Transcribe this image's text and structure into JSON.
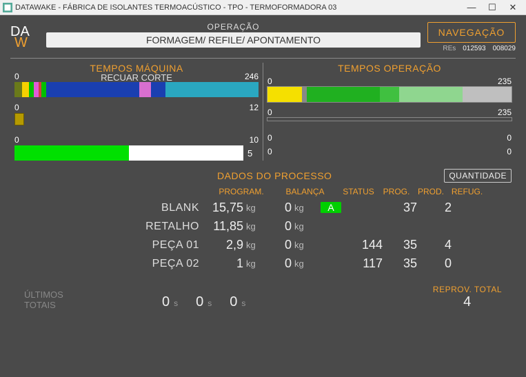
{
  "window": {
    "title": "DATAWAKE - FÁBRICA DE ISOLANTES TERMOACÚSTICO - TPO - TERMOFORMADORA 03"
  },
  "header": {
    "operacao_label": "OPERAÇÃO",
    "operacao_value": "FORMAGEM/ REFILE/ APONTAMENTO",
    "nav_label": "NAVEGAÇÃO",
    "res_label": "REs",
    "res_v1": "012593",
    "res_v2": "008029"
  },
  "charts_left": {
    "title": "TEMPOS MÁQUINA",
    "subtitle": "RECUAR CORTE",
    "bar1": {
      "min": "0",
      "max": "246"
    },
    "bar2": {
      "min": "0",
      "max": "12"
    },
    "bar3": {
      "min": "0",
      "max": "10",
      "value_label": "5"
    }
  },
  "charts_right": {
    "title": "TEMPOS OPERAÇÃO",
    "bar1": {
      "min": "0",
      "max": "235"
    },
    "bar2": {
      "min": "0",
      "max": "235"
    },
    "small1": {
      "l": "0",
      "r": "0"
    },
    "small2": {
      "l": "0",
      "r": "0"
    }
  },
  "process": {
    "title": "DADOS DO PROCESSO",
    "qty_label": "QUANTIDADE",
    "cols": {
      "program": "PROGRAM.",
      "balanca": "BALANÇA",
      "status": "STATUS",
      "prog": "PROG.",
      "prod": "PROD.",
      "refug": "REFUG."
    },
    "unit_kg": "kg",
    "rows": [
      {
        "label": "BLANK",
        "program": "15,75",
        "bal": "0",
        "status": "A",
        "prog": "",
        "prod": "37",
        "refug": "2"
      },
      {
        "label": "RETALHO",
        "program": "11,85",
        "bal": "0",
        "status": "",
        "prog": "",
        "prod": "",
        "refug": ""
      },
      {
        "label": "PEÇA 01",
        "program": "2,9",
        "bal": "0",
        "status": "",
        "prog": "144",
        "prod": "35",
        "refug": "4"
      },
      {
        "label": "PEÇA 02",
        "program": "1",
        "bal": "0",
        "status": "",
        "prog": "117",
        "prod": "35",
        "refug": "0"
      }
    ]
  },
  "footer": {
    "left_l1": "ÚLTIMOS",
    "left_l2": "TOTAIS",
    "t1": "0",
    "u1": "s",
    "t2": "0",
    "u2": "s",
    "t3": "0",
    "u3": "s",
    "reprov_label": "REPROV. TOTAL",
    "reprov_value": "4"
  },
  "chart_data": [
    {
      "type": "bar",
      "title": "TEMPOS MÁQUINA — bar 1 (RECUAR CORTE)",
      "xlim": [
        0,
        246
      ],
      "series": [
        {
          "name": "seg1",
          "color": "#6a7a1a",
          "width_pct": 3
        },
        {
          "name": "seg2",
          "color": "#f5d000",
          "width_pct": 3
        },
        {
          "name": "seg3",
          "color": "#00c000",
          "width_pct": 2
        },
        {
          "name": "seg4",
          "color": "#e05bd6",
          "width_pct": 2
        },
        {
          "name": "seg5",
          "color": "#d04040",
          "width_pct": 1
        },
        {
          "name": "seg6",
          "color": "#00c000",
          "width_pct": 2
        },
        {
          "name": "seg7",
          "color": "#1a3fb0",
          "width_pct": 38
        },
        {
          "name": "seg8",
          "color": "#d86fd0",
          "width_pct": 5
        },
        {
          "name": "seg9",
          "color": "#1a3fb0",
          "width_pct": 6
        },
        {
          "name": "seg10",
          "color": "#2aa7c0",
          "width_pct": 38
        }
      ]
    },
    {
      "type": "bar",
      "title": "TEMPOS MÁQUINA — bar 2",
      "xlim": [
        0,
        12
      ],
      "series": [
        {
          "name": "seg1",
          "color": "#b59a00",
          "width_pct": 4
        }
      ]
    },
    {
      "type": "bar",
      "title": "TEMPOS MÁQUINA — bar 3",
      "xlim": [
        0,
        10
      ],
      "value": 5,
      "series": [
        {
          "name": "fill",
          "color": "#00e000",
          "width_pct": 50
        }
      ]
    },
    {
      "type": "bar",
      "title": "TEMPOS OPERAÇÃO — bar 1",
      "xlim": [
        0,
        235
      ],
      "series": [
        {
          "name": "seg1",
          "color": "#f5e000",
          "width_pct": 14
        },
        {
          "name": "seg2",
          "color": "#888888",
          "width_pct": 2
        },
        {
          "name": "seg3",
          "color": "#20b020",
          "width_pct": 30
        },
        {
          "name": "seg4",
          "color": "#40c040",
          "width_pct": 8
        },
        {
          "name": "seg5",
          "color": "#8fd68f",
          "width_pct": 26
        },
        {
          "name": "seg6",
          "color": "#bfbfbf",
          "width_pct": 20
        }
      ]
    },
    {
      "type": "bar",
      "title": "TEMPOS OPERAÇÃO — bar 2",
      "xlim": [
        0,
        235
      ],
      "series": []
    }
  ]
}
